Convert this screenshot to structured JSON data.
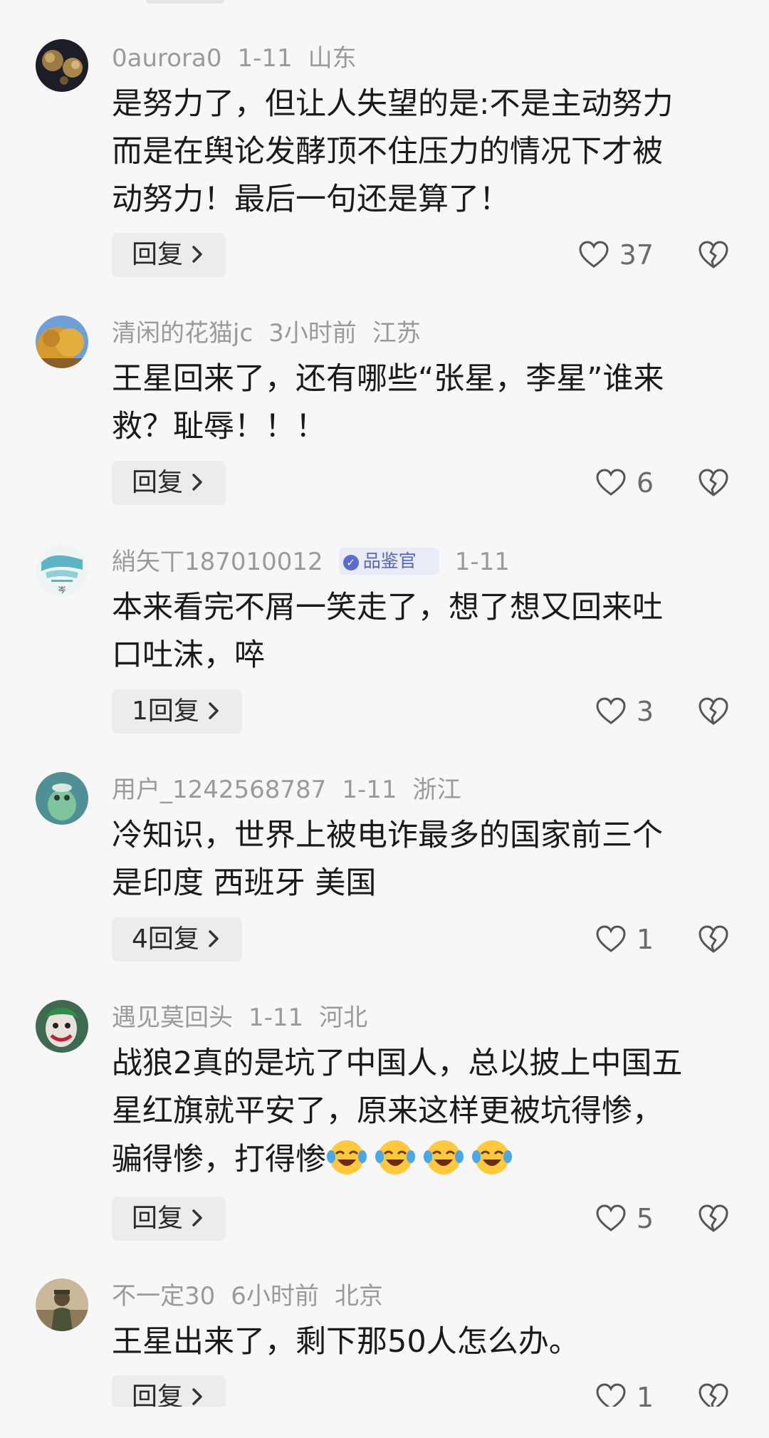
{
  "reply_label": "回复",
  "comments": [
    {
      "username": "0aurora0",
      "date": "1-11",
      "location": "山东",
      "badge": "",
      "lines": [
        "是努力了，但让人失望的是:不是主动努力",
        "而是在舆论发酵顶不住压力的情况下才被",
        "动努力！最后一句还是算了！"
      ],
      "reply_count": "",
      "likes": "37"
    },
    {
      "username": "清闲的花猫jc",
      "date": "3小时前",
      "location": "江苏",
      "badge": "",
      "lines": [
        "王星回来了，还有哪些“张星，李星”谁来",
        "救？耻辱！！！"
      ],
      "reply_count": "",
      "likes": "6"
    },
    {
      "username": "綃矢丅187010012",
      "date": "1-11",
      "location": "",
      "badge": "品鉴官",
      "lines": [
        "本来看完不屑一笑走了，想了想又回来吐",
        "口吐沫，啐"
      ],
      "reply_count": "1",
      "likes": "3"
    },
    {
      "username": "用户_1242568787",
      "date": "1-11",
      "location": "浙江",
      "badge": "",
      "lines": [
        "冷知识，世界上被电诈最多的国家前三个",
        "是印度 西班牙 美国"
      ],
      "reply_count": "4",
      "likes": "1"
    },
    {
      "username": "遇见莫回头",
      "date": "1-11",
      "location": "河北",
      "badge": "",
      "lines": [
        "战狼2真的是坑了中国人，总以披上中国五",
        "星红旗就平安了，原来这样更被坑得惨，",
        "骗得惨，打得惨"
      ],
      "reply_count": "",
      "likes": "5",
      "emoji_count": 4
    },
    {
      "username": "不一定30",
      "date": "6小时前",
      "location": "北京",
      "badge": "",
      "lines": [
        "王星出来了，剩下那50人怎么办。"
      ],
      "reply_count": "",
      "likes": "1"
    }
  ]
}
